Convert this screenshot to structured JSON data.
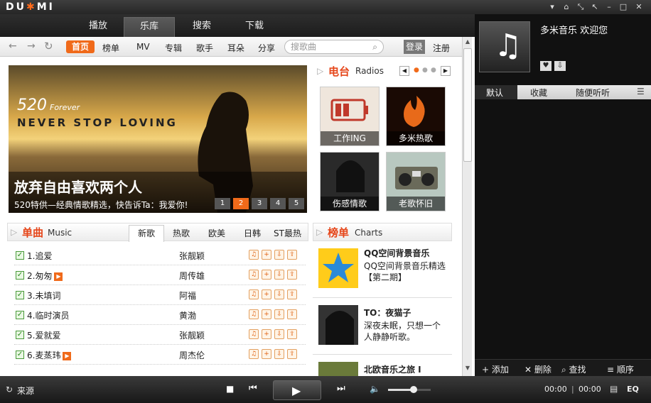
{
  "app": {
    "logo": "DU*MI"
  },
  "window_buttons": [
    "▾",
    "⌂",
    "⤡",
    "↖",
    "–",
    "□",
    "✕"
  ],
  "nav_tabs": [
    {
      "label": "播放"
    },
    {
      "label": "乐库",
      "active": true
    },
    {
      "label": "搜索"
    },
    {
      "label": "下载"
    }
  ],
  "toolbar": {
    "home": "首页",
    "links": [
      "榜单",
      "MV",
      "专辑",
      "歌手",
      "耳朵",
      "分享"
    ],
    "search_placeholder": "搜歌曲",
    "login": "登录",
    "register": "注册"
  },
  "banner": {
    "line1": "520",
    "line1b": "Forever",
    "line2": "NEVER STOP LOVING",
    "headline": "放弃自由喜欢两个人",
    "caption": "520特供—经典情歌精选，快告诉Ta：我爱你!",
    "pages": [
      "1",
      "2",
      "3",
      "4",
      "5"
    ],
    "active_page": 2
  },
  "radio": {
    "title": "电台",
    "subtitle": "Radios",
    "tiles": [
      {
        "label": "工作ING"
      },
      {
        "label": "多米热歌"
      },
      {
        "label": "伤感情歌"
      },
      {
        "label": "老歌怀旧"
      }
    ]
  },
  "singles": {
    "title": "单曲",
    "subtitle": "Music",
    "tabs": [
      "新歌",
      "热歌",
      "欧美",
      "日韩",
      "ST最热"
    ],
    "active_tab": 0,
    "rows": [
      {
        "num": "1",
        "name": "追爱",
        "artist": "张靓颖",
        "mv": false
      },
      {
        "num": "2",
        "name": "匆匆",
        "artist": "周传雄",
        "mv": true
      },
      {
        "num": "3",
        "name": "未填词",
        "artist": "阿福",
        "mv": false
      },
      {
        "num": "4",
        "name": "临时演员",
        "artist": "黄渤",
        "mv": false
      },
      {
        "num": "5",
        "name": "爱就爱",
        "artist": "张靓颖",
        "mv": false
      },
      {
        "num": "6",
        "name": "麦蒸玮",
        "artist": "周杰伦",
        "mv": true
      }
    ]
  },
  "charts": {
    "title": "榜单",
    "subtitle": "Charts",
    "items": [
      {
        "title": "QQ空间背景音乐",
        "desc1": "QQ空间背景音乐精选",
        "desc2": "【第二期】"
      },
      {
        "title": "TO：夜猫子",
        "desc1": "深夜未眠，只想一个",
        "desc2": "人静静听歌。"
      },
      {
        "title": "北欧音乐之旅 I",
        "desc1": "",
        "desc2": ""
      }
    ]
  },
  "right_panel": {
    "welcome": "多米音乐 欢迎您",
    "tabs": [
      "默认",
      "收藏",
      "随便听听"
    ],
    "bottom": [
      "添加",
      "删除",
      "查找",
      "顺序"
    ]
  },
  "player": {
    "source": "来源",
    "time_current": "00:00",
    "time_total": "00:00",
    "eq": "EQ",
    "volume": 0.6
  },
  "colors": {
    "accent": "#f06a1a",
    "section_title": "#e6461a"
  }
}
